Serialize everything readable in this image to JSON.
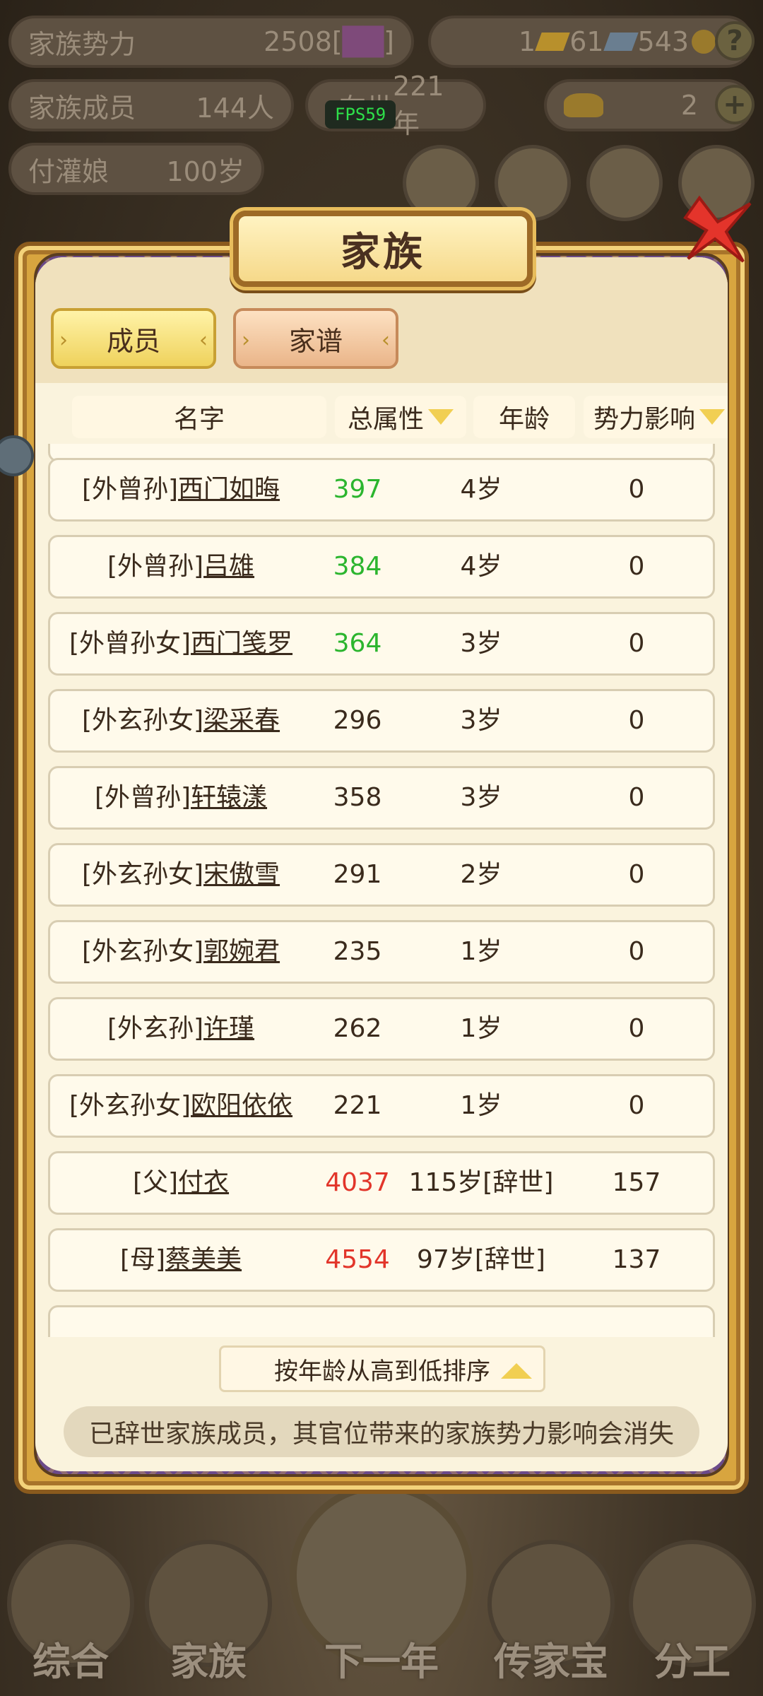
{
  "colors": {
    "score_green": "#2bb52e",
    "score_red": "#e2352a",
    "text_default": "#3a2a1c"
  },
  "hud": {
    "clan_power_label": "家族势力",
    "clan_power_value": "2508[",
    "clan_power_tag": "██",
    "clan_power_suffix": "]",
    "gold_bars": "1",
    "silver": "61",
    "tickets": "543",
    "help_icon": "?",
    "members_label": "家族成员",
    "members_value": "144人",
    "reign_label": "在世",
    "reign_value": "221年",
    "ingot_count": "2",
    "add_icon": "+",
    "leader_name": "付灌娘",
    "leader_age": "100岁",
    "fps": "FPS59"
  },
  "bottom_nav": {
    "items": [
      "综合",
      "家族",
      "下一年",
      "传家宝",
      "分工"
    ]
  },
  "dialog": {
    "title": "家族",
    "tabs": {
      "members": "成员",
      "genealogy": "家谱"
    },
    "headers": {
      "name": "名字",
      "score": "总属性",
      "age": "年龄",
      "influence": "势力影响"
    },
    "rows": [
      {
        "relation": "[外曾孙]",
        "name": "西门如晦",
        "score": "397",
        "age": "4岁",
        "influence": "0",
        "color": "green"
      },
      {
        "relation": "[外曾孙]",
        "name": "吕雄",
        "score": "384",
        "age": "4岁",
        "influence": "0",
        "color": "green"
      },
      {
        "relation": "[外曾孙女]",
        "name": "西门笺罗",
        "score": "364",
        "age": "3岁",
        "influence": "0",
        "color": "green"
      },
      {
        "relation": "[外玄孙女]",
        "name": "梁采春",
        "score": "296",
        "age": "3岁",
        "influence": "0",
        "color": "default"
      },
      {
        "relation": "[外曾孙]",
        "name": "轩辕漾",
        "score": "358",
        "age": "3岁",
        "influence": "0",
        "color": "default"
      },
      {
        "relation": "[外玄孙女]",
        "name": "宋傲雪",
        "score": "291",
        "age": "2岁",
        "influence": "0",
        "color": "default"
      },
      {
        "relation": "[外玄孙女]",
        "name": "郭婉君",
        "score": "235",
        "age": "1岁",
        "influence": "0",
        "color": "default"
      },
      {
        "relation": "[外玄孙]",
        "name": "许瑾",
        "score": "262",
        "age": "1岁",
        "influence": "0",
        "color": "default"
      },
      {
        "relation": "[外玄孙女]",
        "name": "欧阳依依",
        "score": "221",
        "age": "1岁",
        "influence": "0",
        "color": "default"
      },
      {
        "relation": "[父]",
        "name": "付衣",
        "score": "4037",
        "age": "115岁[辞世]",
        "influence": "157",
        "color": "red"
      },
      {
        "relation": "[母]",
        "name": "蔡美美",
        "score": "4554",
        "age": "97岁[辞世]",
        "influence": "137",
        "color": "red"
      }
    ],
    "sort_label": "按年龄从高到低排序",
    "notice": "已辞世家族成员，其官位带来的家族势力影响会消失"
  }
}
